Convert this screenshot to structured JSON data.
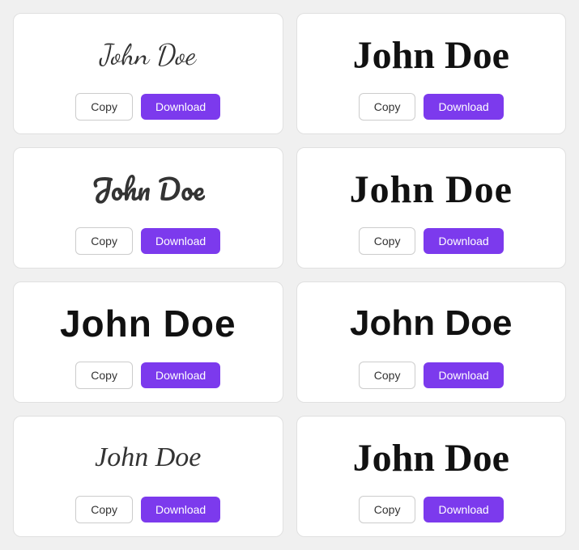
{
  "cards": [
    {
      "id": "card-1",
      "name": "John Doe",
      "font_class": "font-cursive-1",
      "copy_label": "Copy",
      "download_label": "Download"
    },
    {
      "id": "card-2",
      "name": "John Doe",
      "font_class": "font-serif-bold-1",
      "copy_label": "Copy",
      "download_label": "Download"
    },
    {
      "id": "card-3",
      "name": "John Doe",
      "font_class": "font-cursive-2",
      "copy_label": "Copy",
      "download_label": "Download"
    },
    {
      "id": "card-4",
      "name": "John Doe",
      "font_class": "font-serif-bold-2",
      "copy_label": "Copy",
      "download_label": "Download"
    },
    {
      "id": "card-5",
      "name": "John Doe",
      "font_class": "font-sans-bold-1",
      "copy_label": "Copy",
      "download_label": "Download"
    },
    {
      "id": "card-6",
      "name": "John Doe",
      "font_class": "font-sans-bold-2",
      "copy_label": "Copy",
      "download_label": "Download"
    },
    {
      "id": "card-7",
      "name": "John Doe",
      "font_class": "font-handwriting-1",
      "copy_label": "Copy",
      "download_label": "Download"
    },
    {
      "id": "card-8",
      "name": "John Doe",
      "font_class": "font-modern-bold",
      "copy_label": "Copy",
      "download_label": "Download"
    }
  ]
}
